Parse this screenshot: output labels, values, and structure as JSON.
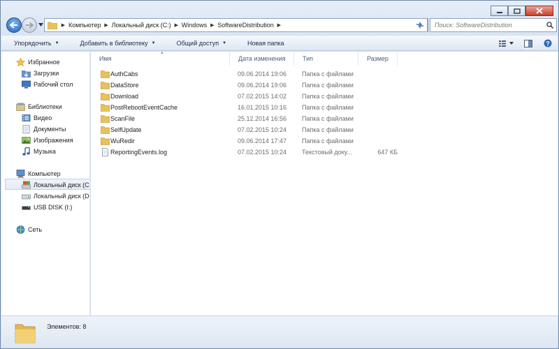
{
  "titlebar": {
    "buttons": [
      {
        "name": "minimize-button",
        "icon": "minimize-icon"
      },
      {
        "name": "maximize-button",
        "icon": "maximize-icon"
      },
      {
        "name": "close-button",
        "icon": "close-icon"
      }
    ]
  },
  "address": {
    "crumbs": [
      "Компьютер",
      "Локальный диск (C:)",
      "Windows",
      "SoftwareDistribution"
    ],
    "search_placeholder": "Поиск: SoftwareDistribution"
  },
  "toolbar": {
    "organize": "Упорядочить",
    "add_to_library": "Добавить в библиотеку",
    "share": "Общий доступ",
    "new_folder": "Новая папка"
  },
  "nav": {
    "favorites": {
      "label": "Избранное",
      "items": [
        "Загрузки",
        "Рабочий стол"
      ]
    },
    "libraries": {
      "label": "Библиотеки",
      "items": [
        "Видео",
        "Документы",
        "Изображения",
        "Музыка"
      ]
    },
    "computer": {
      "label": "Компьютер",
      "items": [
        "Локальный диск (C",
        "Локальный диск (D",
        "USB DISK (I:)"
      ]
    },
    "network": {
      "label": "Сеть"
    }
  },
  "columns": {
    "name": "Имя",
    "date": "Дата изменения",
    "type": "Тип",
    "size": "Размер"
  },
  "files": [
    {
      "name": "AuthCabs",
      "date": "09.06.2014 19:06",
      "type": "Папка с файлами",
      "size": "",
      "icon": "folder-icon"
    },
    {
      "name": "DataStore",
      "date": "09.06.2014 19:06",
      "type": "Папка с файлами",
      "size": "",
      "icon": "folder-icon"
    },
    {
      "name": "Download",
      "date": "07.02.2015 14:02",
      "type": "Папка с файлами",
      "size": "",
      "icon": "folder-icon"
    },
    {
      "name": "PostRebootEventCache",
      "date": "16.01.2015 10:16",
      "type": "Папка с файлами",
      "size": "",
      "icon": "folder-icon"
    },
    {
      "name": "ScanFile",
      "date": "25.12.2014 16:56",
      "type": "Папка с файлами",
      "size": "",
      "icon": "folder-icon"
    },
    {
      "name": "SelfUpdate",
      "date": "07.02.2015 10:24",
      "type": "Папка с файлами",
      "size": "",
      "icon": "folder-icon"
    },
    {
      "name": "WuRedir",
      "date": "09.06.2014 17:47",
      "type": "Папка с файлами",
      "size": "",
      "icon": "folder-icon"
    },
    {
      "name": "ReportingEvents.log",
      "date": "07.02.2015 10:24",
      "type": "Текстовый доку...",
      "size": "647 КБ",
      "icon": "text-file-icon"
    }
  ],
  "status": {
    "items_count": "Элементов: 8"
  },
  "colors": {
    "folder": "#e8c15a",
    "accent": "#2461b8",
    "close": "#c7402c"
  }
}
